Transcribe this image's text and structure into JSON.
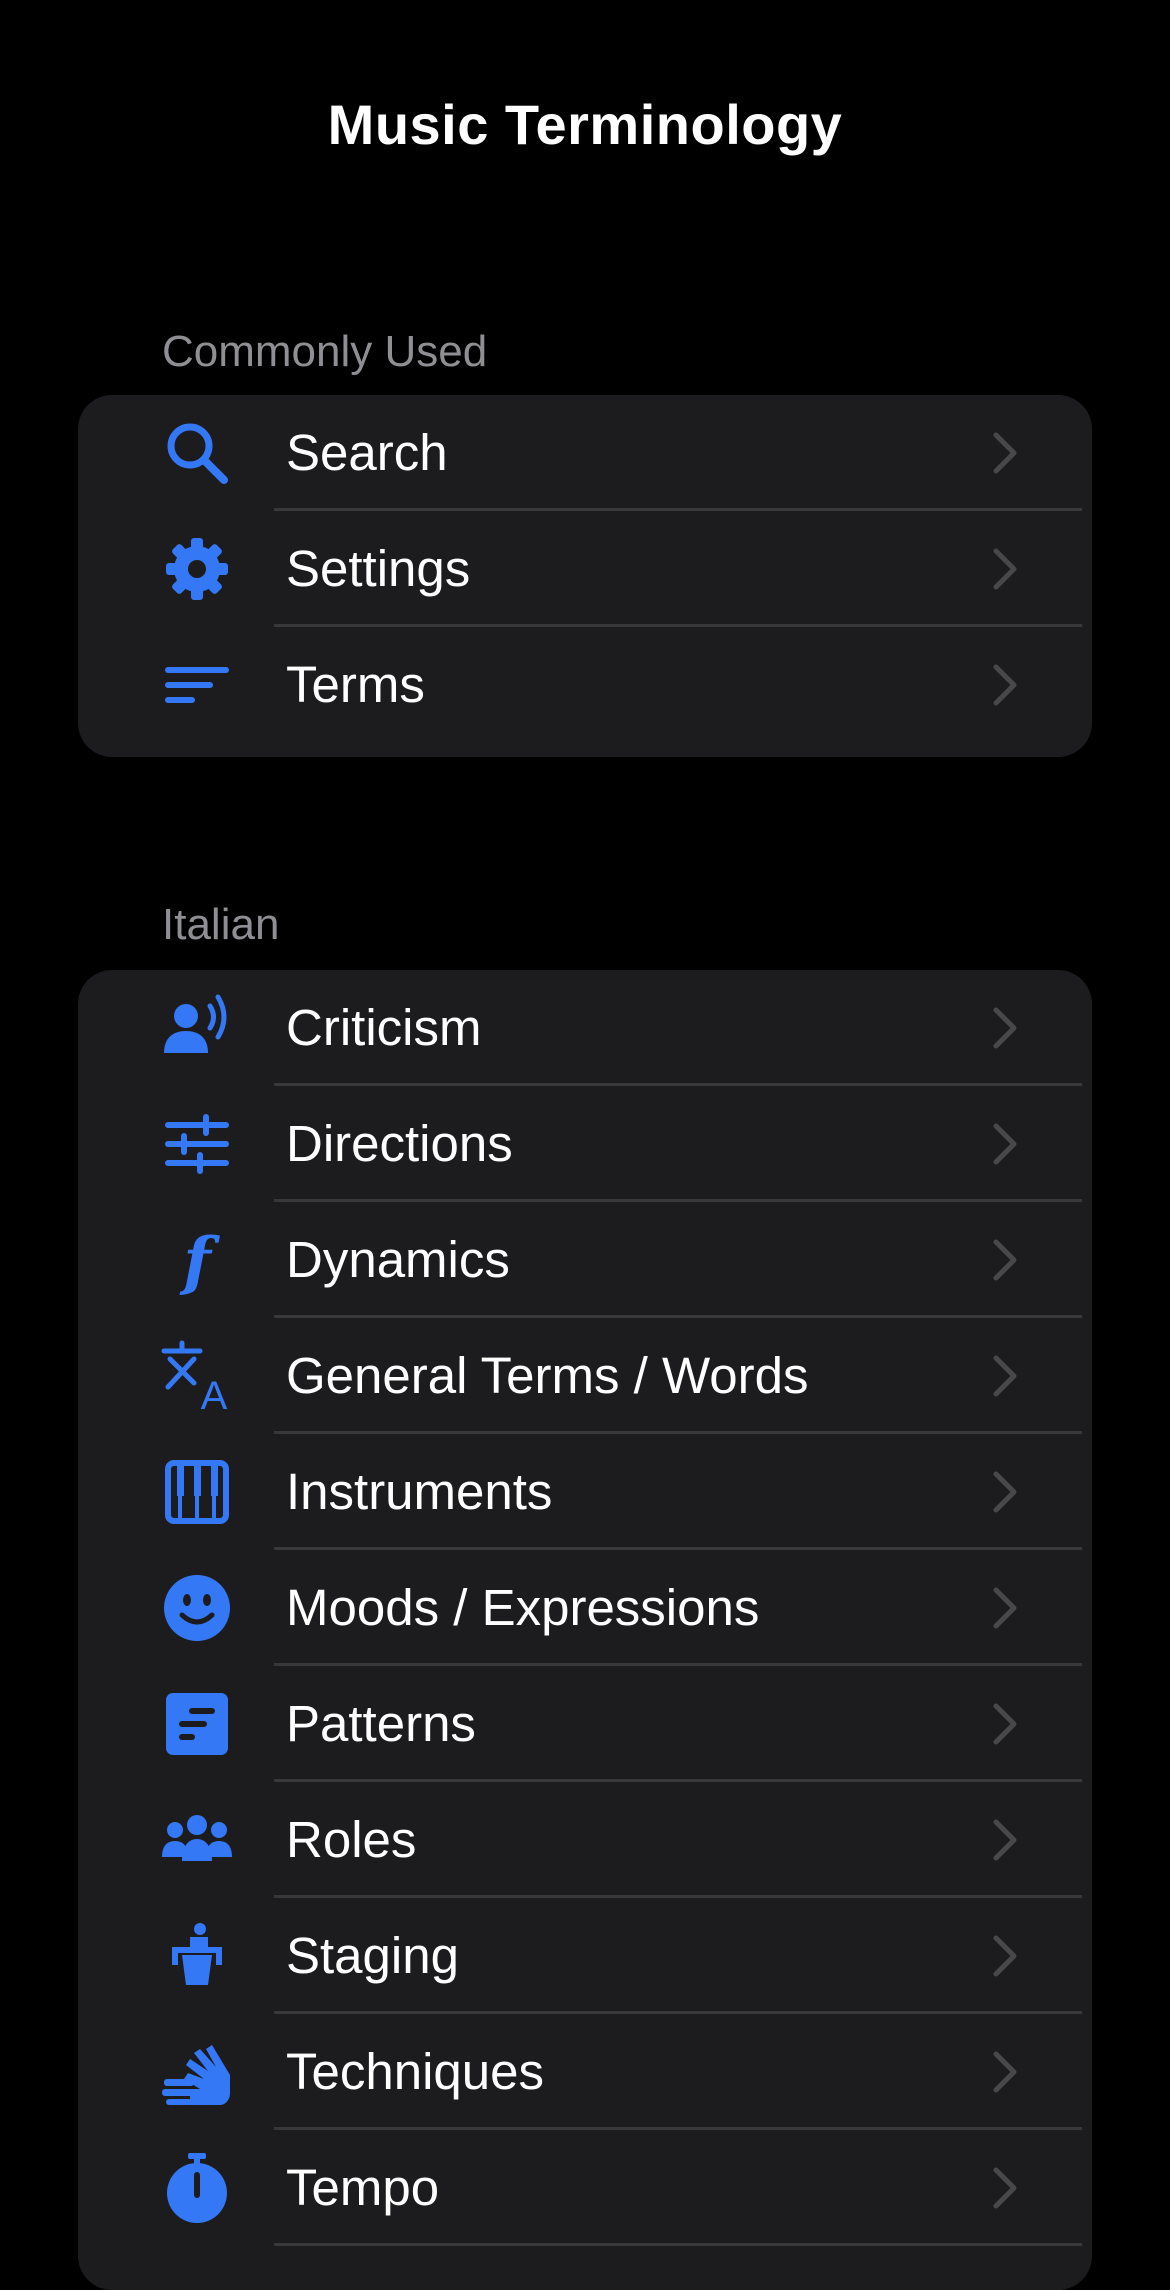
{
  "nav": {
    "title": "Music Terminology"
  },
  "sections": {
    "common": {
      "header": "Commonly Used",
      "rows": [
        {
          "label": "Search",
          "icon": "search-icon"
        },
        {
          "label": "Settings",
          "icon": "gear-icon"
        },
        {
          "label": "Terms",
          "icon": "list-icon"
        }
      ]
    },
    "italian": {
      "header": "Italian",
      "rows": [
        {
          "label": "Criticism",
          "icon": "person-speaking-icon"
        },
        {
          "label": "Directions",
          "icon": "sliders-icon"
        },
        {
          "label": "Dynamics",
          "icon": "forte-icon"
        },
        {
          "label": "General Terms / Words",
          "icon": "translate-icon"
        },
        {
          "label": "Instruments",
          "icon": "piano-icon"
        },
        {
          "label": "Moods / Expressions",
          "icon": "smiley-icon"
        },
        {
          "label": "Patterns",
          "icon": "pattern-icon"
        },
        {
          "label": "Roles",
          "icon": "group-icon"
        },
        {
          "label": "Staging",
          "icon": "stage-icon"
        },
        {
          "label": "Techniques",
          "icon": "hands-icon"
        },
        {
          "label": "Tempo",
          "icon": "stopwatch-icon"
        }
      ]
    }
  },
  "colors": {
    "background": "#000000",
    "group_background": "#1c1c1e",
    "accent": "#3478f6",
    "separator": "#38383a",
    "header_text": "#8e8e93",
    "chevron": "#48484a"
  }
}
